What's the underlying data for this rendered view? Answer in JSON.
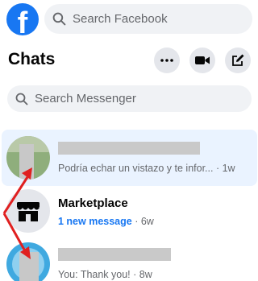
{
  "header": {
    "logo_letter": "f",
    "search_placeholder": "Search Facebook"
  },
  "chats_panel": {
    "title": "Chats",
    "search_placeholder": "Search Messenger",
    "conversations": [
      {
        "name": "",
        "preview": "Podría echar un vistazo y te infor...",
        "separator": " · ",
        "time": "1w",
        "active": true,
        "name_redacted": true
      },
      {
        "name": "Marketplace",
        "preview": "1 new message",
        "separator": " · ",
        "time": "6w",
        "unread": true
      },
      {
        "name": "",
        "preview": "You: Thank you!",
        "separator": " · ",
        "time": "8w",
        "name_redacted": true
      }
    ]
  },
  "colors": {
    "brand": "#1877f2",
    "active_row": "#eaf3ff",
    "annotation_arrow": "#e02020"
  }
}
